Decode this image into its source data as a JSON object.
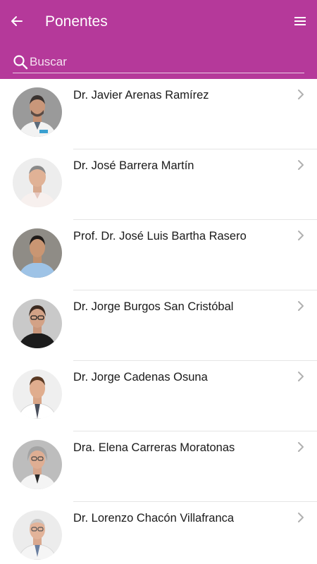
{
  "header": {
    "title": "Ponentes",
    "back_icon": "arrow-left-icon",
    "menu_icon": "hamburger-menu-icon",
    "background": "#b5399a"
  },
  "search": {
    "placeholder": "Buscar",
    "value": "",
    "icon": "search-icon"
  },
  "speakers": [
    {
      "name": "Dr. Javier Arenas Ramírez"
    },
    {
      "name": "Dr. José Barrera Martín"
    },
    {
      "name": "Prof. Dr. José Luis Bartha Rasero"
    },
    {
      "name": "Dr. Jorge Burgos San Cristóbal"
    },
    {
      "name": "Dr. Jorge Cadenas Osuna"
    },
    {
      "name": "Dra. Elena Carreras Moratonas"
    },
    {
      "name": "Dr. Lorenzo Chacón Villafranca"
    }
  ]
}
